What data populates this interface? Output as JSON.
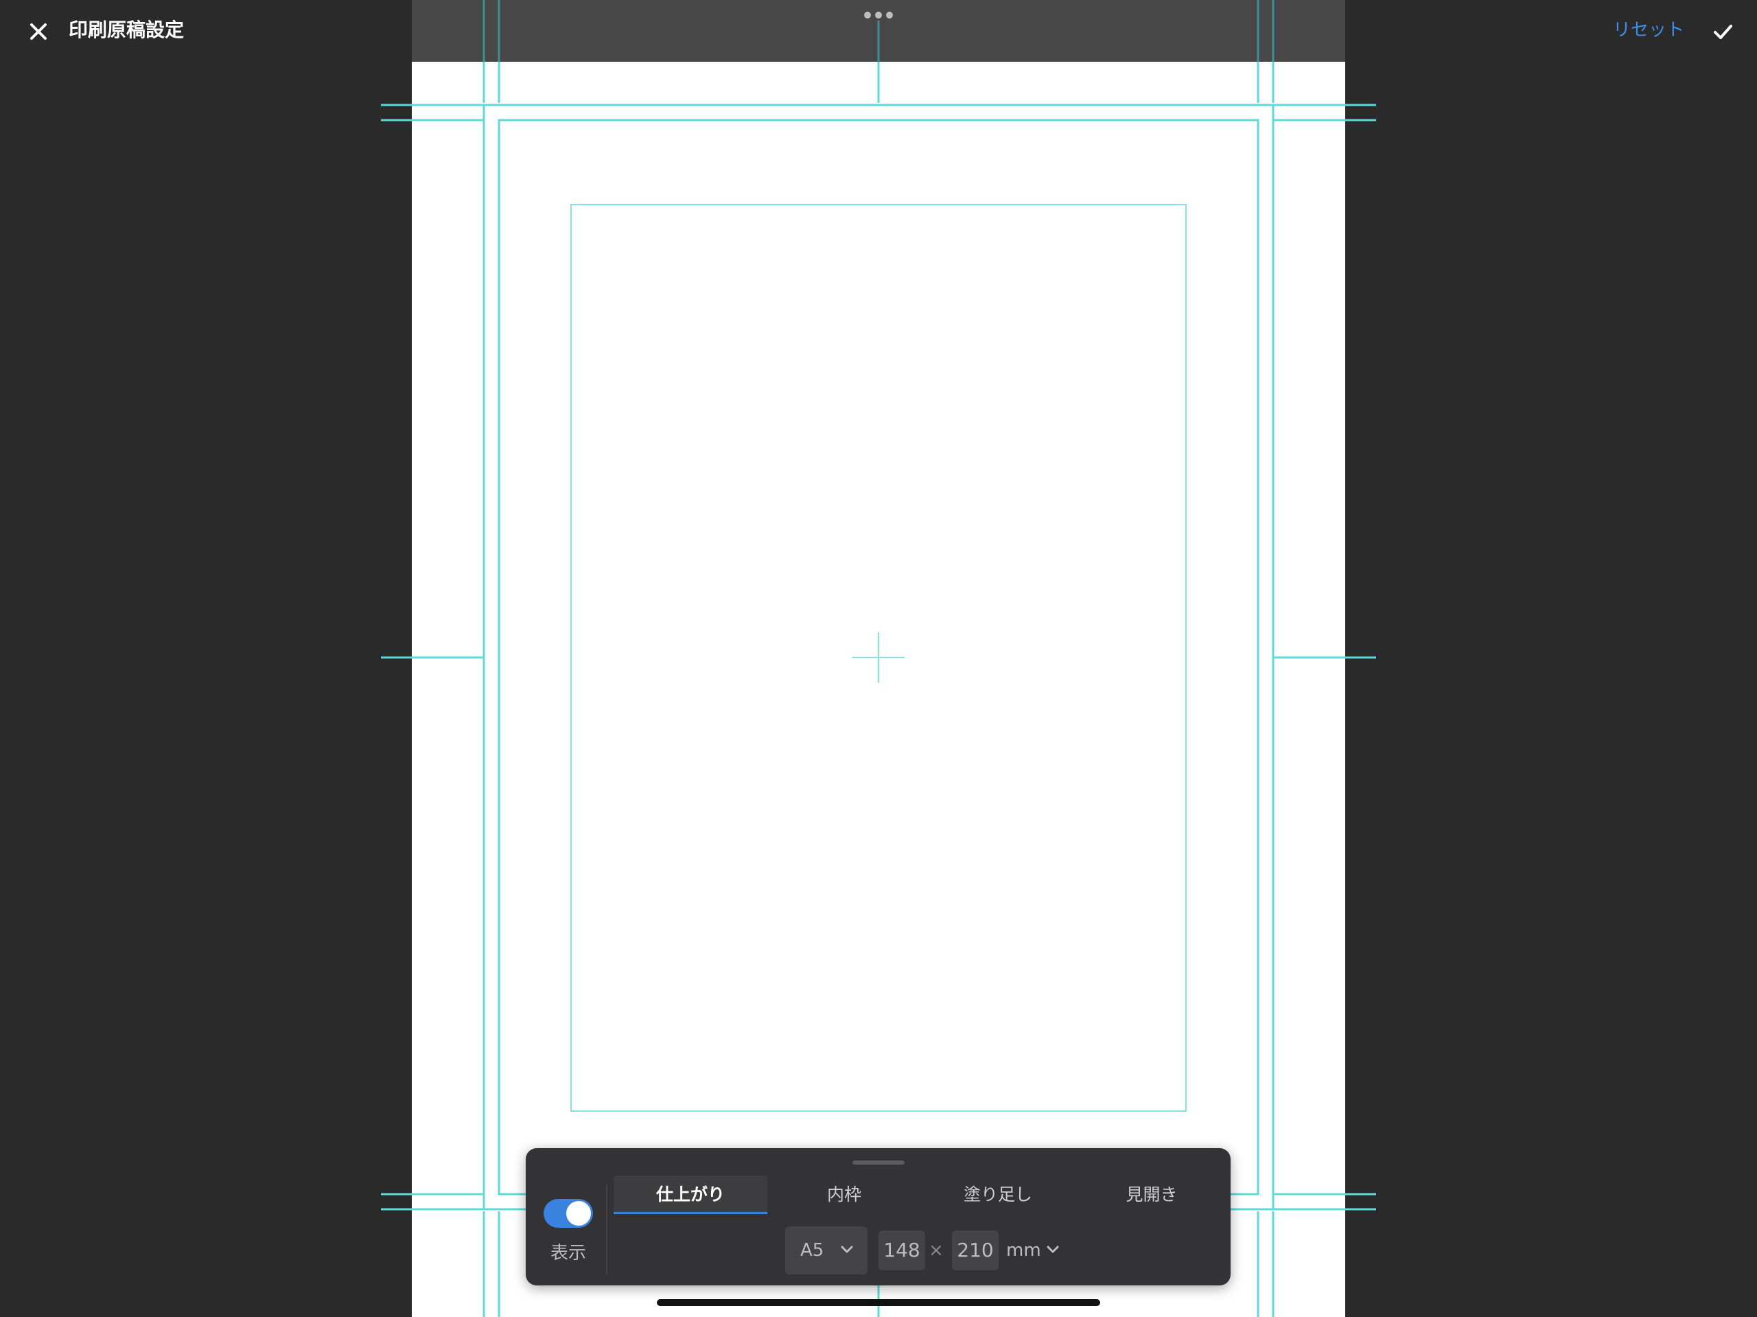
{
  "header": {
    "title": "印刷原稿設定",
    "reset_label": "リセット",
    "accent_color": "#3d8fe6"
  },
  "icons": {
    "close": "close-icon",
    "confirm": "checkmark-icon",
    "more": "more-horizontal-icon"
  },
  "panel": {
    "show_label": "表示",
    "toggle_on": true,
    "tabs": [
      {
        "label": "仕上がり",
        "active": true
      },
      {
        "label": "内枠",
        "active": false
      },
      {
        "label": "塗り足し",
        "active": false
      },
      {
        "label": "見開き",
        "active": false
      }
    ],
    "paper_size": "A5",
    "width": "148",
    "times_sign": "×",
    "height": "210",
    "unit": "mm"
  },
  "colors": {
    "guide": "#5fd9d9",
    "toggle": "#3a82e0",
    "canvas": "#ffffff",
    "background": "#2a2a2a"
  }
}
